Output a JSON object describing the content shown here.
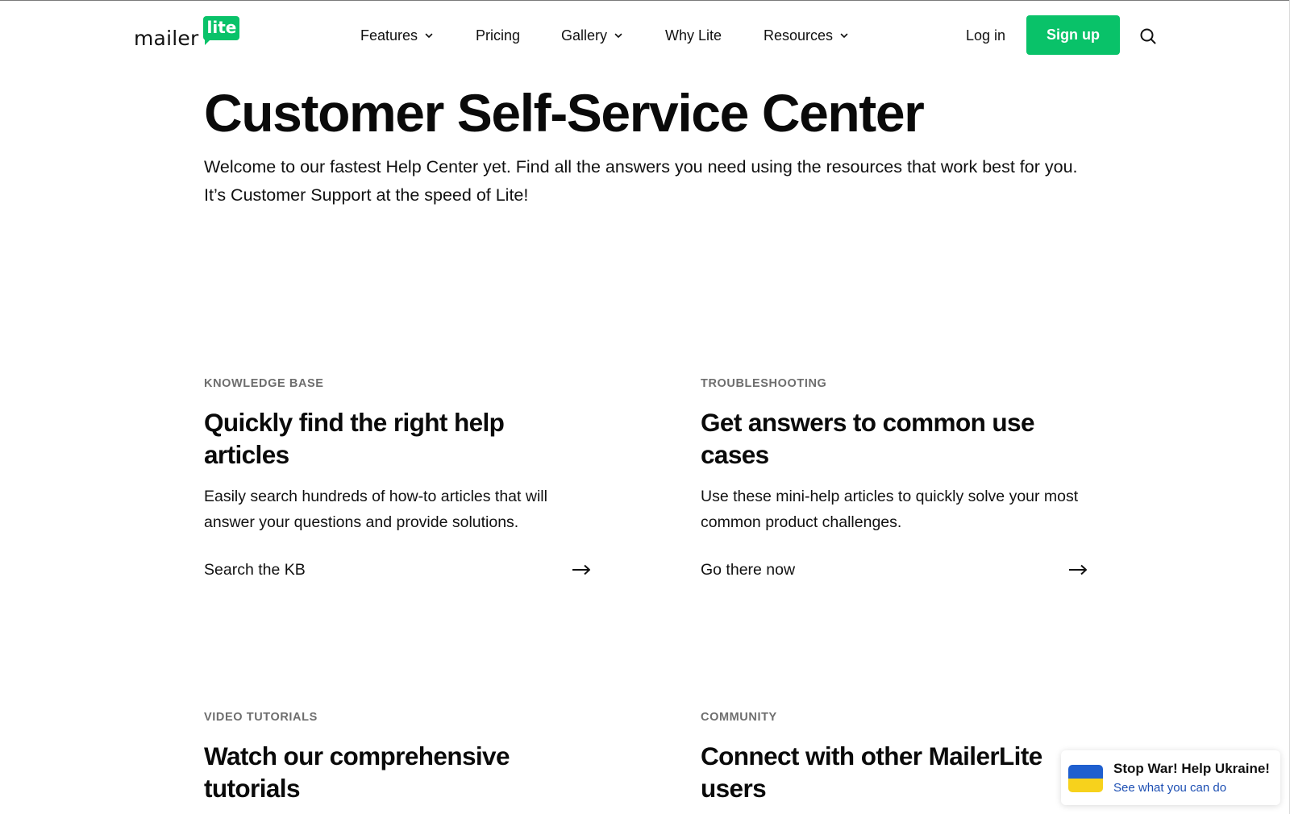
{
  "header": {
    "logo_main": "mailer",
    "logo_badge": "lite",
    "nav": [
      {
        "label": "Features",
        "has_dropdown": true
      },
      {
        "label": "Pricing",
        "has_dropdown": false
      },
      {
        "label": "Gallery",
        "has_dropdown": true
      },
      {
        "label": "Why Lite",
        "has_dropdown": false
      },
      {
        "label": "Resources",
        "has_dropdown": true
      }
    ],
    "login_label": "Log in",
    "signup_label": "Sign up",
    "search_icon": "search-icon"
  },
  "hero": {
    "title": "Customer Self-Service Center",
    "subtitle": "Welcome to our fastest Help Center yet. Find all the answers you need using the resources that work best for you. It’s Customer Support at the speed of Lite!"
  },
  "cards": [
    {
      "eyebrow": "KNOWLEDGE BASE",
      "title": "Quickly find the right help articles",
      "description": "Easily search hundreds of how-to articles that will answer your questions and provide solutions.",
      "link": "Search the KB"
    },
    {
      "eyebrow": "TROUBLESHOOTING",
      "title": "Get answers to common use cases",
      "description": "Use these mini-help articles to quickly solve your most common product challenges.",
      "link": "Go there now"
    },
    {
      "eyebrow": "VIDEO TUTORIALS",
      "title": "Watch our comprehensive tutorials"
    },
    {
      "eyebrow": "COMMUNITY",
      "title": "Connect with other MailerLite users"
    }
  ],
  "ukraine_banner": {
    "title": "Stop War! Help Ukraine!",
    "link": "See what you can do"
  },
  "colors": {
    "brand_green": "#09c269",
    "ukraine_blue": "#1f5fcf",
    "ukraine_yellow": "#f7d21c",
    "link_blue": "#1d4fb3"
  }
}
